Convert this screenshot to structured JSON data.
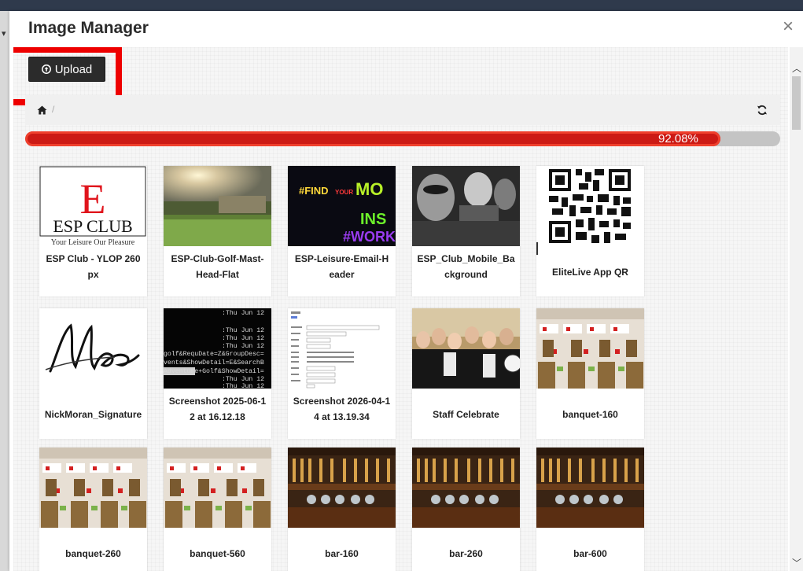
{
  "modal": {
    "title": "Image Manager",
    "close_label": "×"
  },
  "toolbar": {
    "upload_label": "Upload"
  },
  "breadcrumb": {
    "separator": "/"
  },
  "progress": {
    "value": 92.08,
    "label": "92.08%"
  },
  "colors": {
    "progress_fill": "#cc1a14",
    "highlight": "#ee0000",
    "upload_button": "#2b2b2b"
  },
  "images": [
    {
      "label": "ESP Club - YLOP 260px",
      "logo_letter": "E",
      "logo_name": "ESP CLUB",
      "logo_tagline": "Your Leisure Our Pleasure"
    },
    {
      "label": "ESP-Club-Golf-Mast-Head-Flat"
    },
    {
      "label": "ESP-Leisure-Email-Header",
      "poster_line1a": "#FIND ",
      "poster_line1b": "YOUR",
      "poster_line1c": "MO",
      "poster_line2": "INS",
      "poster_line3": "#WORK"
    },
    {
      "label": "ESP_Club_Mobile_Background"
    },
    {
      "label": "EliteLive App QR"
    },
    {
      "label": "NickMoran_Signature"
    },
    {
      "label": "Screenshot 2025-06-12 at 16.12.18",
      "terminal_lines": [
        ":Thu Jun 12",
        ":Thu Jun 12",
        ":Thu Jun 12",
        ":Thu Jun 12",
        "golf&RequDate=Z&GroupDesc=",
        "vents&ShowDetail=E&SearchB",
        "Adventure+Golf&ShowDetail=",
        ":Thu Jun 12",
        ":Thu Jun 12"
      ]
    },
    {
      "label": "Screenshot 2026-04-14 at 13.19.34"
    },
    {
      "label": "Staff Celebrate"
    },
    {
      "label": "banquet-160"
    },
    {
      "label": "banquet-260"
    },
    {
      "label": "banquet-560"
    },
    {
      "label": "bar-160"
    },
    {
      "label": "bar-260"
    },
    {
      "label": "bar-600"
    }
  ]
}
